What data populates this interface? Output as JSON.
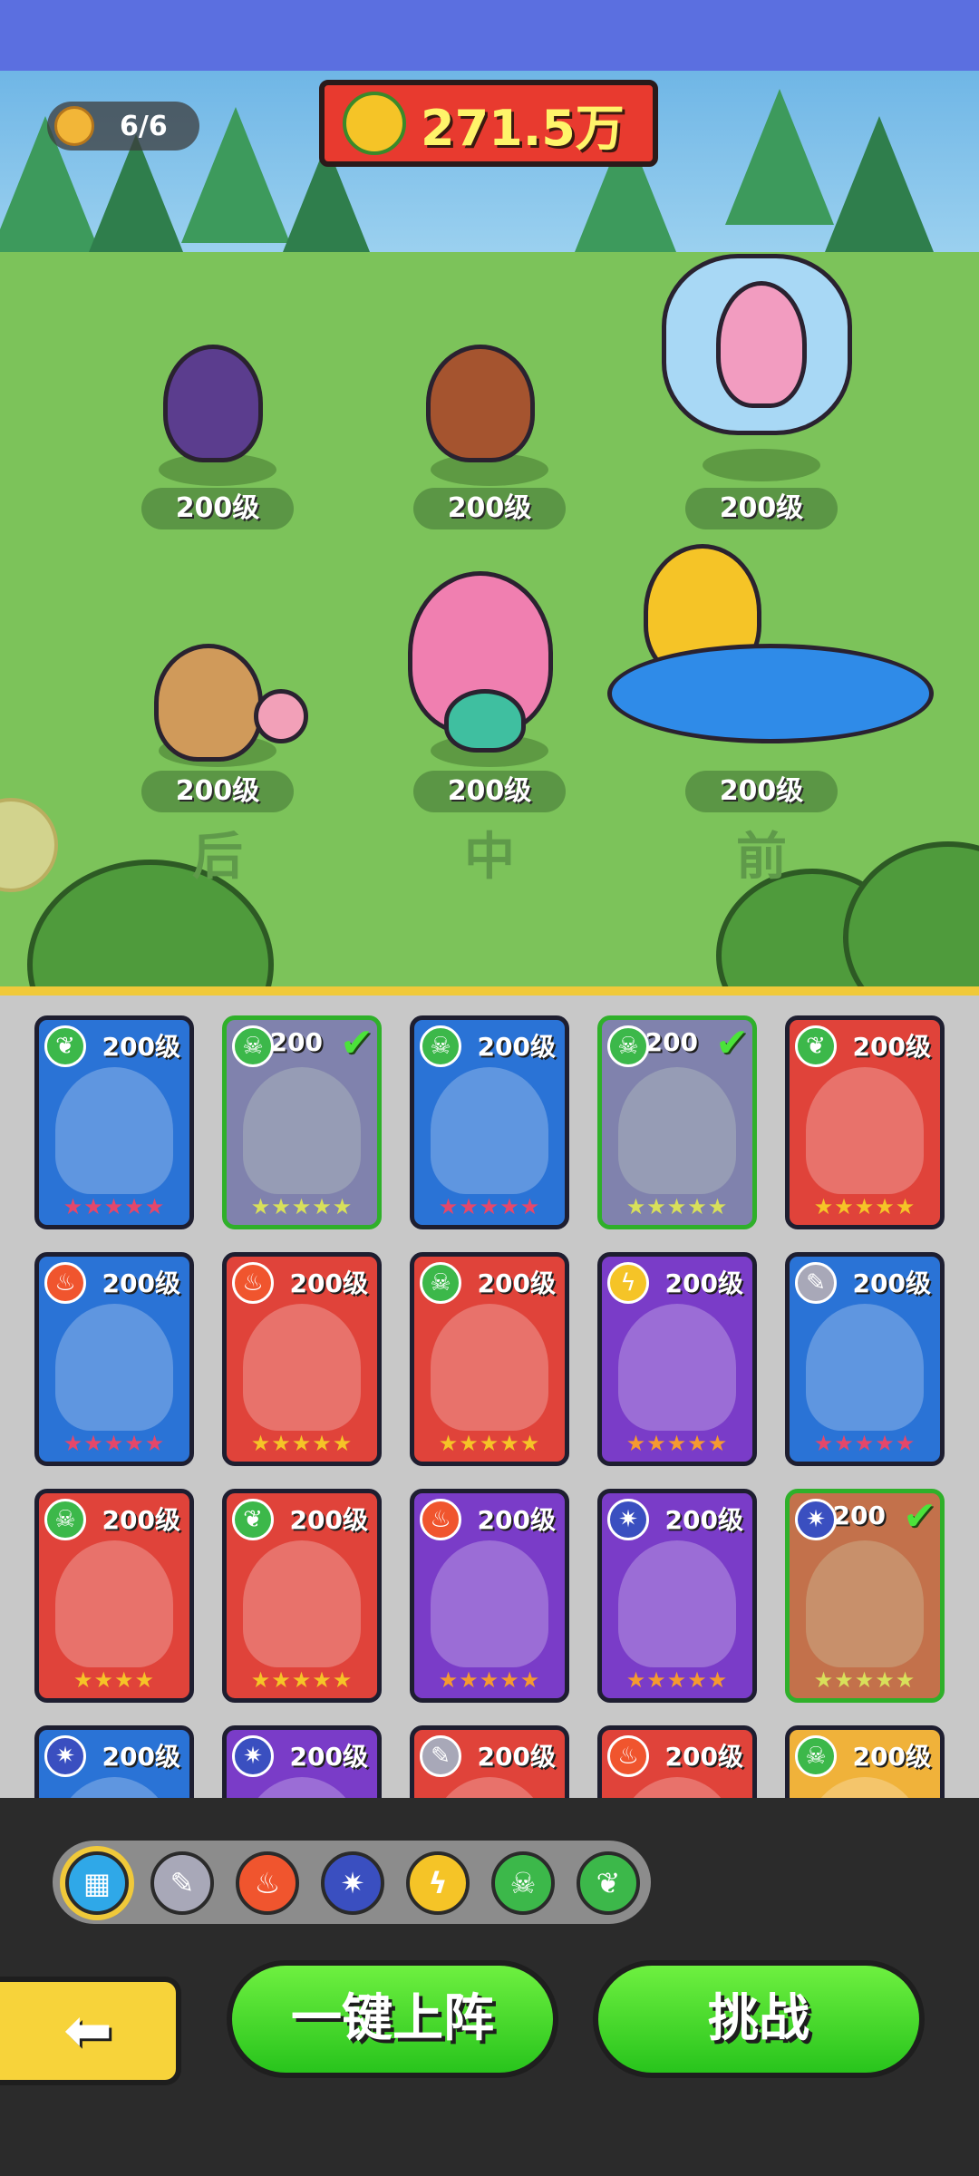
{
  "battle": {
    "team_count": "6/6",
    "power": "271.5万",
    "row_labels": {
      "back": "后",
      "middle": "中",
      "front": "前"
    },
    "heroes": [
      {
        "name": "plague-doctor-bird",
        "level": "200级",
        "row": "back"
      },
      {
        "name": "hooded-mouse",
        "level": "200级",
        "row": "middle"
      },
      {
        "name": "fairy",
        "level": "200级",
        "row": "front"
      },
      {
        "name": "reindeer-kid",
        "level": "200级",
        "row": "back"
      },
      {
        "name": "mermaid",
        "level": "200级",
        "row": "middle"
      },
      {
        "name": "pirate-chick",
        "level": "200级",
        "row": "front"
      }
    ]
  },
  "roster": {
    "cards": [
      {
        "level": "200级",
        "element": "nature",
        "color": "#2a73d6",
        "selected": false,
        "stars": "★★★★★",
        "star_color": "#e5476a"
      },
      {
        "level": "200",
        "element": "poison",
        "color": "#7a5cd0",
        "selected": true,
        "stars": "★★★★★",
        "star_color": "#d8e05a"
      },
      {
        "level": "200级",
        "element": "poison",
        "color": "#2a73d6",
        "selected": false,
        "stars": "★★★★★",
        "star_color": "#e5476a"
      },
      {
        "level": "200",
        "element": "poison",
        "color": "#7a5cd0",
        "selected": true,
        "stars": "★★★★★",
        "star_color": "#d8e05a"
      },
      {
        "level": "200级",
        "element": "nature",
        "color": "#e0433a",
        "selected": false,
        "stars": "★★★★★",
        "star_color": "#f5c427"
      },
      {
        "level": "200级",
        "element": "fire",
        "color": "#2a73d6",
        "selected": false,
        "stars": "★★★★★",
        "star_color": "#e5476a"
      },
      {
        "level": "200级",
        "element": "fire",
        "color": "#e0433a",
        "selected": false,
        "stars": "★★★★★",
        "star_color": "#f5c427"
      },
      {
        "level": "200级",
        "element": "poison",
        "color": "#e0433a",
        "selected": false,
        "stars": "★★★★★",
        "star_color": "#f5c427"
      },
      {
        "level": "200级",
        "element": "lightning",
        "color": "#7a3cc8",
        "selected": false,
        "stars": "★★★★★",
        "star_color": "#f59a30"
      },
      {
        "level": "200级",
        "element": "sword",
        "color": "#2a73d6",
        "selected": false,
        "stars": "★★★★★",
        "star_color": "#e5476a"
      },
      {
        "level": "200级",
        "element": "poison",
        "color": "#e0433a",
        "selected": false,
        "stars": "★★★★",
        "star_color": "#f5c427"
      },
      {
        "level": "200级",
        "element": "nature",
        "color": "#e0433a",
        "selected": false,
        "stars": "★★★★★",
        "star_color": "#f5c427"
      },
      {
        "level": "200级",
        "element": "fire",
        "color": "#7a3cc8",
        "selected": false,
        "stars": "★★★★★",
        "star_color": "#f59a30"
      },
      {
        "level": "200级",
        "element": "ice",
        "color": "#7a3cc8",
        "selected": false,
        "stars": "★★★★★",
        "star_color": "#f59a30"
      },
      {
        "level": "200",
        "element": "ice",
        "color": "#e0433a",
        "selected": true,
        "stars": "★★★★★",
        "star_color": "#d8e05a"
      },
      {
        "level": "200级",
        "element": "ice",
        "color": "#2a73d6",
        "selected": false,
        "stars": "",
        "star_color": "#e5476a"
      },
      {
        "level": "200级",
        "element": "ice",
        "color": "#7a3cc8",
        "selected": false,
        "stars": "",
        "star_color": "#f59a30"
      },
      {
        "level": "200级",
        "element": "sword",
        "color": "#e0433a",
        "selected": false,
        "stars": "",
        "star_color": "#f5c427"
      },
      {
        "level": "200级",
        "element": "fire",
        "color": "#e0433a",
        "selected": false,
        "stars": "",
        "star_color": "#f5c427"
      },
      {
        "level": "200级",
        "element": "poison",
        "color": "#f0b23a",
        "selected": false,
        "stars": "",
        "star_color": "#f5c427"
      }
    ]
  },
  "filters": [
    {
      "name": "all",
      "glyph": "▦",
      "color": "#2fa8e8",
      "active": true
    },
    {
      "name": "sword",
      "glyph": "✎",
      "color": "#a8a8b8",
      "active": false
    },
    {
      "name": "fire",
      "glyph": "♨",
      "color": "#f0552e",
      "active": false
    },
    {
      "name": "ice",
      "glyph": "✷",
      "color": "#3a4fc0",
      "active": false
    },
    {
      "name": "lightning",
      "glyph": "ϟ",
      "color": "#f5c427",
      "active": false
    },
    {
      "name": "poison",
      "glyph": "☠",
      "color": "#3cb84a",
      "active": false
    },
    {
      "name": "nature",
      "glyph": "❦",
      "color": "#3cb84a",
      "active": false
    }
  ],
  "element_glyphs": {
    "nature": "❦",
    "poison": "☠",
    "fire": "♨",
    "lightning": "ϟ",
    "sword": "✎",
    "ice": "✷"
  },
  "element_colors": {
    "nature": "#3cb84a",
    "poison": "#3cb84a",
    "fire": "#f0552e",
    "lightning": "#f5c427",
    "sword": "#a8a8b8",
    "ice": "#3a4fc0"
  },
  "buttons": {
    "back_glyph": "⬅",
    "auto_deploy": "一键上阵",
    "challenge": "挑战"
  }
}
